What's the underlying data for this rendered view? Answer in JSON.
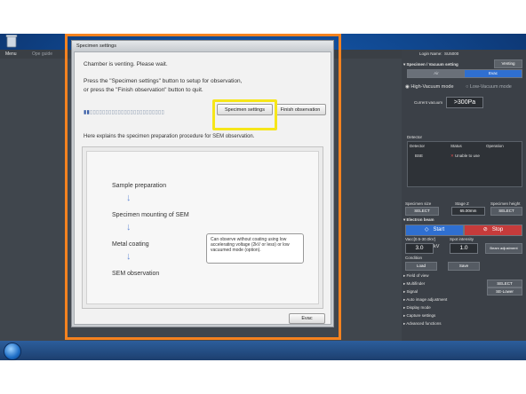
{
  "desktop": {
    "menu_label": "Menu",
    "ope_guide_label": "Ope guide"
  },
  "right_panel": {
    "login_name_label": "Login Name:",
    "login_name": "SU5000",
    "section_specimen": "Specimen / Vacuum setting",
    "status_badge": "Venting",
    "air_button": "Air",
    "evac_button": "Evac",
    "high_vacuum_mode": "High-Vacuum mode",
    "low_vacuum_mode": "Low-Vacuum mode",
    "current_vacuum_label": "Current vacuum",
    "current_vacuum_value": ">300Pa",
    "detector_section": "Detector",
    "detector_headers": [
      "Detector",
      "Status",
      "Operation"
    ],
    "detector_row": {
      "name": "BSE",
      "status": "Unable to use"
    },
    "specimen_size_label": "Specimen size",
    "specimen_size_value": "SELECT",
    "stage_z_label": "Stage Z",
    "stage_z_value": "65.00mm",
    "specimen_height_label": "Specimen height",
    "specimen_height_value": "SELECT",
    "electron_beam_section": "Electron beam",
    "start_button": "Start",
    "stop_button": "Stop",
    "vacc_label": "Vacc[0.5-30.0kV]",
    "vacc_value": "3.0",
    "vacc_unit": "kV",
    "spot_intensity_label": "Spot intensity",
    "spot_intensity_value": "1.0",
    "beam_adjustment": "Beam adjustment",
    "condition_label": "Condition",
    "load_button": "Load",
    "save_button": "Save",
    "collapsed_sections": [
      "Field of view",
      "Multifinder",
      "Signal",
      "Auto image adjustment",
      "Display mode",
      "Capture settings",
      "Advanced functions"
    ],
    "multifinder_value": "SELECT",
    "signal_value": "SE-Lower"
  },
  "dialog": {
    "title": "Specimen settings",
    "message1": "Chamber is venting. Please wait.",
    "message2": "Press the \"Specimen settings\" button to setup for observation,",
    "message3": "or press the \"Finish observation\" button to quit.",
    "specimen_settings_button": "Specimen settings",
    "finish_observation_button": "Finish observation",
    "explain_text": "Here explains the specimen preparation procedure for SEM observation.",
    "steps": [
      "Sample preparation",
      "Specimen mounting of SEM",
      "Metal  coating",
      "SEM observation"
    ],
    "callout": "Can observe without coating using low accelerating voltage (2kV or less) or low vacuumed mode (option).",
    "evac_button": "Evac"
  },
  "colors": {
    "highlight_orange": "#f5821f",
    "highlight_yellow": "#f6e61a",
    "start_blue": "#2f6fd0",
    "stop_red": "#c63b3b"
  }
}
